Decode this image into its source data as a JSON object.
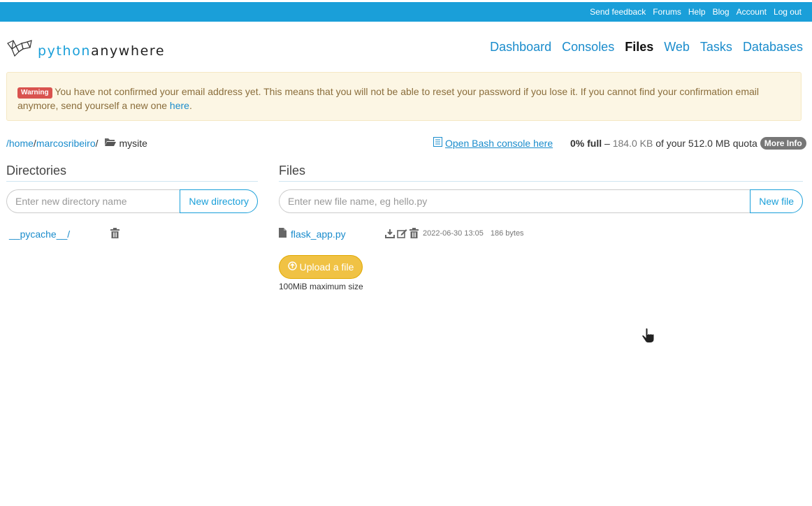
{
  "topbar": {
    "links": [
      "Send feedback",
      "Forums",
      "Help",
      "Blog",
      "Account",
      "Log out"
    ]
  },
  "logo": {
    "part1": "python",
    "part2": "anywhere"
  },
  "nav": {
    "items": [
      "Dashboard",
      "Consoles",
      "Files",
      "Web",
      "Tasks",
      "Databases"
    ],
    "active": "Files"
  },
  "warning": {
    "badge": "Warning",
    "message": "You have not confirmed your email address yet. This means that you will not be able to reset your password if you lose it. If you cannot find your confirmation email anymore, send yourself a new one",
    "link": "here",
    "end": "."
  },
  "breadcrumb": {
    "sep0": "/",
    "home": "home",
    "sep1": "/",
    "user": "marcosribeiro",
    "sep2": "/",
    "current": "mysite"
  },
  "bash": {
    "label": "Open Bash console here"
  },
  "quota": {
    "percent": "0% full",
    "dash": "–",
    "used": "184.0 KB",
    "of_text": "of your 512.0 MB quota",
    "more_info": "More Info"
  },
  "directories": {
    "title": "Directories",
    "placeholder": "Enter new directory name",
    "button": "New directory",
    "items": [
      {
        "name": "__pycache__/"
      }
    ]
  },
  "files": {
    "title": "Files",
    "placeholder": "Enter new file name, eg hello.py",
    "button": "New file",
    "items": [
      {
        "name": "flask_app.py",
        "modified": "2022-06-30 13:05",
        "size": "186 bytes"
      }
    ],
    "upload_label": "Upload a file",
    "max_size": "100MiB maximum size"
  },
  "colors": {
    "brand": "#1a9fd9",
    "warning_bg": "#fcf6e4",
    "upload": "#f0c244"
  }
}
